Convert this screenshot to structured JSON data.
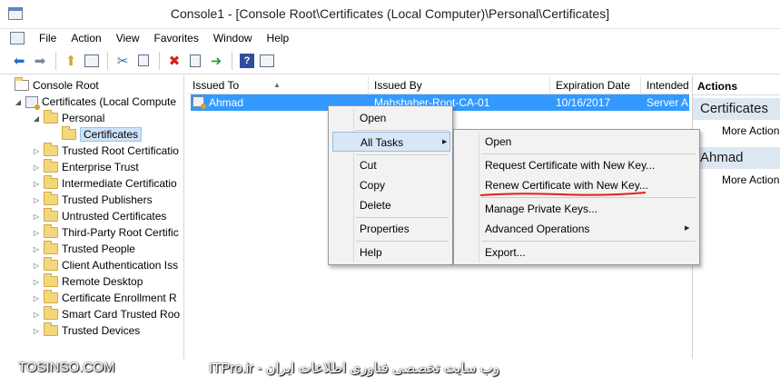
{
  "window": {
    "title": "Console1 - [Console Root\\Certificates (Local Computer)\\Personal\\Certificates]"
  },
  "menubar": {
    "items": [
      "File",
      "Action",
      "View",
      "Favorites",
      "Window",
      "Help"
    ]
  },
  "toolbar": {
    "buttons": [
      "back-icon",
      "forward-icon",
      "up-icon",
      "show-tree-icon",
      "cut-icon",
      "copy-icon",
      "delete-icon",
      "properties-icon",
      "export-icon",
      "help-icon",
      "show-action-pane-icon"
    ]
  },
  "tree": {
    "root": "Console Root",
    "certs_local": "Certificates (Local Compute",
    "personal": "Personal",
    "certificates": "Certificates",
    "children": [
      "Trusted Root Certificatio",
      "Enterprise Trust",
      "Intermediate Certificatio",
      "Trusted Publishers",
      "Untrusted Certificates",
      "Third-Party Root Certific",
      "Trusted People",
      "Client Authentication Iss",
      "Remote Desktop",
      "Certificate Enrollment R",
      "Smart Card Trusted Roo",
      "Trusted Devices"
    ]
  },
  "list": {
    "columns": [
      "Issued To",
      "Issued By",
      "Expiration Date",
      "Intended"
    ],
    "rows": [
      {
        "issued_to": "Ahmad",
        "issued_by": "Mahshaher-Root-CA-01",
        "expiration": "10/16/2017",
        "intended": "Server A"
      }
    ]
  },
  "actions_pane": {
    "header": "Actions",
    "section1": "Certificates",
    "more1": "More Action",
    "section2": "Ahmad",
    "more2": "More Action"
  },
  "context_menu": {
    "open": "Open",
    "all_tasks": "All Tasks",
    "cut": "Cut",
    "copy": "Copy",
    "delete": "Delete",
    "properties": "Properties",
    "help": "Help"
  },
  "submenu": {
    "open": "Open",
    "request_new_key": "Request Certificate with New Key...",
    "renew_new_key": "Renew Certificate with New Key...",
    "manage_private_keys": "Manage Private Keys...",
    "advanced_operations": "Advanced Operations",
    "export": "Export..."
  },
  "watermark": {
    "left": "TOSINSO.COM",
    "right": "ITPro.ir - وب سایت تخصصی فناوری اطلاعات ایران"
  },
  "colors": {
    "selection": "#3399ff",
    "highlight_menu": "#d8e6f5",
    "action_section": "#dde7f2",
    "annotation": "#e0201e"
  }
}
